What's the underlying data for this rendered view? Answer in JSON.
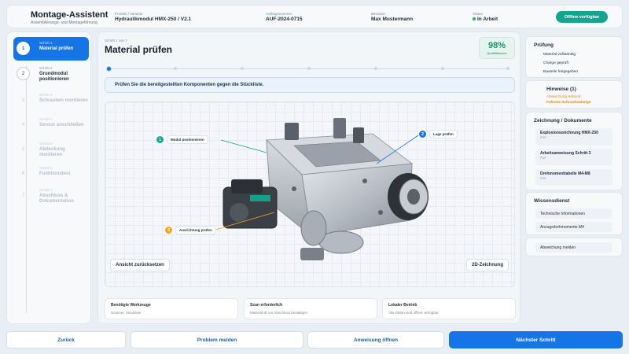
{
  "header": {
    "title": "Montage-Assistent",
    "subtitle": "Assemblierungs- und Montageführung",
    "product_label": "Produkt / Variante",
    "product_value": "Hydraulikmodul HMX-250 / V2.1",
    "order_label": "Auftragsnummer",
    "order_value": "AUF-2024-0715",
    "user_label": "Benutzer",
    "user_value": "Max Mustermann",
    "status_label": "Status",
    "status_value": "In Arbeit",
    "offline_button": "Offline verfügbar",
    "accent": "#13a58f"
  },
  "steps": [
    {
      "num": "1",
      "label": "Schritt 1",
      "text": "Material prüfen"
    },
    {
      "num": "2",
      "label": "Schritt 2",
      "text": "Grundmodul positionieren"
    },
    {
      "num": "3",
      "label": "Schritt 3",
      "text": "Schrauben montieren"
    },
    {
      "num": "4",
      "label": "Schritt 4",
      "text": "Sensor anschließen"
    },
    {
      "num": "5",
      "label": "Schritt 5",
      "text": "Abdeckung montieren"
    },
    {
      "num": "6",
      "label": "Schritt 6",
      "text": "Funktionstest"
    },
    {
      "num": "7",
      "label": "Schritt 7",
      "text": "Abschluss & Dokumentation"
    }
  ],
  "main": {
    "step_of": "Schritt 1 von 7",
    "title": "Material prüfen",
    "quality_value": "98%",
    "quality_label": "Qualitätsscore",
    "instruction": "Prüfen Sie die bereitgestellten Komponenten gegen die Stückliste.",
    "callouts": [
      {
        "num": "1",
        "text": "Modul positionieren",
        "color": "#13a58f"
      },
      {
        "num": "2",
        "text": "Lage prüfen",
        "color": "#1574e6"
      },
      {
        "num": "3",
        "text": "Ausrichtung prüfen",
        "color": "#f0a51c"
      }
    ],
    "reset_view": "Ansicht zurücksetzen",
    "drawing_2d": "2D-Zeichnung",
    "info": [
      {
        "title": "Benötigte Werkzeuge",
        "text": "Scanner, Stückliste"
      },
      {
        "title": "Scan erforderlich",
        "text": "Material-ID vor Abschluss bestätigen"
      },
      {
        "title": "Lokaler Betrieb",
        "text": "Alle Daten sind offline verfügbar"
      }
    ]
  },
  "right": {
    "check_title": "Prüfung",
    "checks": [
      "Material vollständig",
      "Charge geprüft",
      "Bauteile freigegeben"
    ],
    "hints_title": "Hinweise (1)",
    "hint_line1": "Abweichung erkannt:",
    "hint_line2": "Falsche Schraubenlänge",
    "docs_title": "Zeichnung / Dokumente",
    "docs": [
      {
        "name": "Explosionszeichnung HMX-250",
        "type": "PDF"
      },
      {
        "name": "Arbeitsanweisung Schritt 3",
        "type": "PDF"
      },
      {
        "name": "Drehmomenttabelle M4-M8",
        "type": "PDF"
      }
    ],
    "knowledge_title": "Wissensdienst",
    "knowledge": [
      "Technische Informationen",
      "Anzugsdrehmomente M4"
    ],
    "report_deviation": "Abweichung melden"
  },
  "footer": {
    "back": "Zurück",
    "report_problem": "Problem melden",
    "open_instruction": "Anweisung öffnen",
    "next_step": "Nächster Schritt"
  },
  "colors": {
    "primary": "#1574e6",
    "success": "#17946a",
    "warning": "#e08a12"
  }
}
